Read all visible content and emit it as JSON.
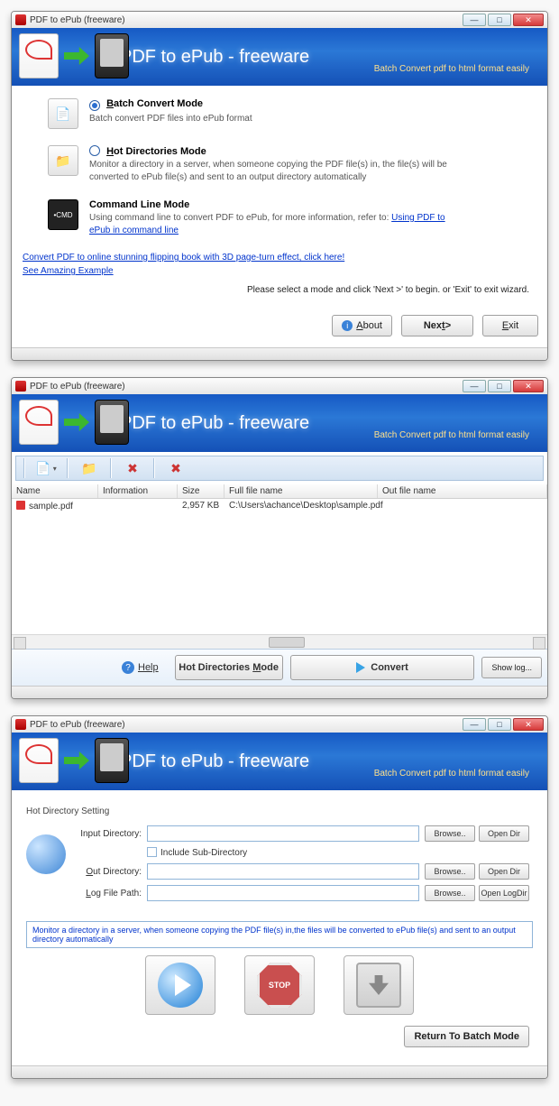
{
  "app_title": "PDF to ePub (freeware)",
  "banner_title": "PDF to ePub - freeware",
  "banner_sub": "Batch Convert pdf to html format easily",
  "win1": {
    "modes": [
      {
        "radio_checked": true,
        "title_key": "B",
        "title_rest": "atch Convert Mode",
        "desc": "Batch convert PDF files into ePub format"
      },
      {
        "radio_checked": false,
        "title_key": "H",
        "title_rest": "ot Directories Mode",
        "desc": "Monitor a directory in a server, when someone copying the PDF file(s) in, the file(s) will be converted to ePub file(s) and sent to an output directory automatically"
      },
      {
        "radio_checked": null,
        "title_key": "",
        "title_rest": "Command Line Mode",
        "desc_prefix": "Using command line to convert PDF to ePub, for more information, refer to: ",
        "desc_link": "Using PDF to ePub in command line"
      }
    ],
    "link1": "Convert PDF to online stunning flipping book with 3D page-turn effect, click here!",
    "link2": "See Amazing Example ",
    "instruction": "Please select a mode and click 'Next >' to begin. or 'Exit' to exit wizard.",
    "btn_about": "About",
    "btn_next": "Next>",
    "btn_exit": "Exit"
  },
  "win2": {
    "columns": [
      "Name",
      "Information",
      "Size",
      "Full file name",
      "Out file name"
    ],
    "row": {
      "name": "sample.pdf",
      "info": "",
      "size": "2,957 KB",
      "full": "C:\\Users\\achance\\Desktop\\sample.pdf",
      "out": ""
    },
    "help": "Help",
    "mode_btn": "Hot Directories Mode",
    "convert": "Convert",
    "showlog": "Show log..."
  },
  "win3": {
    "section": "Hot Directory Setting",
    "label_input_dir": "Input Directory:",
    "label_include_sub": "Include Sub-Directory",
    "label_out_dir": "Out Directory:",
    "label_log_path": "Log File Path:",
    "btn_browse": "Browse..",
    "btn_opendir": "Open Dir",
    "btn_openlogdir": "Open LogDir",
    "note": "Monitor a directory in a server, when someone copying the PDF file(s) in,the files will be converted to ePub file(s) and sent to an output directory automatically",
    "stop": "STOP",
    "return": "Return To Batch Mode"
  }
}
